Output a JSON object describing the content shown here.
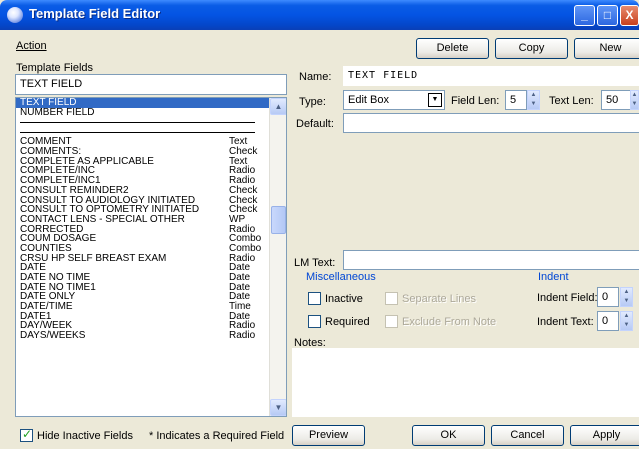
{
  "window": {
    "title": "Template Field Editor",
    "controls": [
      "_",
      "□",
      "X"
    ]
  },
  "menu": {
    "action_label": "Action"
  },
  "toolbar": {
    "delete_label": "Delete",
    "copy_label": "Copy",
    "new_label": "New"
  },
  "left_panel": {
    "label": "Template Fields",
    "selected_field": "TEXT FIELD",
    "items": [
      {
        "name": "TEXT FIELD",
        "type": "",
        "selected": true
      },
      {
        "name": "NUMBER FIELD",
        "type": ""
      },
      {
        "name": "",
        "type": "",
        "separator": true
      },
      {
        "name": "",
        "type": "",
        "separator": true
      },
      {
        "name": "COMMENT",
        "type": "Text"
      },
      {
        "name": "COMMENTS:",
        "type": "Check"
      },
      {
        "name": "COMPLETE AS APPLICABLE",
        "type": "Text"
      },
      {
        "name": "COMPLETE/INC",
        "type": "Radio"
      },
      {
        "name": "COMPLETE/INC1",
        "type": "Radio"
      },
      {
        "name": "CONSULT REMINDER2",
        "type": "Check"
      },
      {
        "name": "CONSULT TO AUDIOLOGY INITIATED",
        "type": "Check"
      },
      {
        "name": "CONSULT TO OPTOMETRY INITIATED",
        "type": "Check"
      },
      {
        "name": "CONTACT LENS - SPECIAL OTHER",
        "type": "WP"
      },
      {
        "name": "CORRECTED",
        "type": "Radio"
      },
      {
        "name": "COUM DOSAGE",
        "type": "Combo"
      },
      {
        "name": "COUNTIES",
        "type": "Combo"
      },
      {
        "name": "CRSU HP SELF BREAST EXAM",
        "type": "Radio"
      },
      {
        "name": "DATE",
        "type": "Date"
      },
      {
        "name": "DATE NO TIME",
        "type": "Date"
      },
      {
        "name": "DATE NO TIME1",
        "type": "Date"
      },
      {
        "name": "DATE ONLY",
        "type": "Date"
      },
      {
        "name": "DATE/TIME",
        "type": "Time"
      },
      {
        "name": "DATE1",
        "type": "Date"
      },
      {
        "name": "DAY/WEEK",
        "type": "Radio"
      },
      {
        "name": "DAYS/WEEKS",
        "type": "Radio"
      }
    ]
  },
  "editor": {
    "name_label": "Name:",
    "name_value": "TEXT FIELD",
    "type_label": "Type:",
    "type_value": "Edit Box",
    "field_len_label": "Field Len:",
    "field_len_value": "5",
    "text_len_label": "Text Len:",
    "text_len_value": "50",
    "default_label": "Default:",
    "default_value": "",
    "lm_text_label": "LM Text:",
    "lm_text_value": "",
    "misc_caption": "Miscellaneous",
    "inactive_label": "Inactive",
    "separate_lines_label": "Separate Lines",
    "required_label": "Required",
    "exclude_label": "Exclude From Note",
    "indent_caption": "Indent",
    "indent_field_label": "Indent Field:",
    "indent_field_value": "0",
    "indent_text_label": "Indent Text:",
    "indent_text_value": "0",
    "notes_label": "Notes:"
  },
  "footer": {
    "hide_inactive_label": "Hide Inactive Fields",
    "hide_inactive_checked": true,
    "required_note": "* Indicates a Required Field",
    "preview_label": "Preview",
    "ok_label": "OK",
    "cancel_label": "Cancel",
    "apply_label": "Apply"
  }
}
